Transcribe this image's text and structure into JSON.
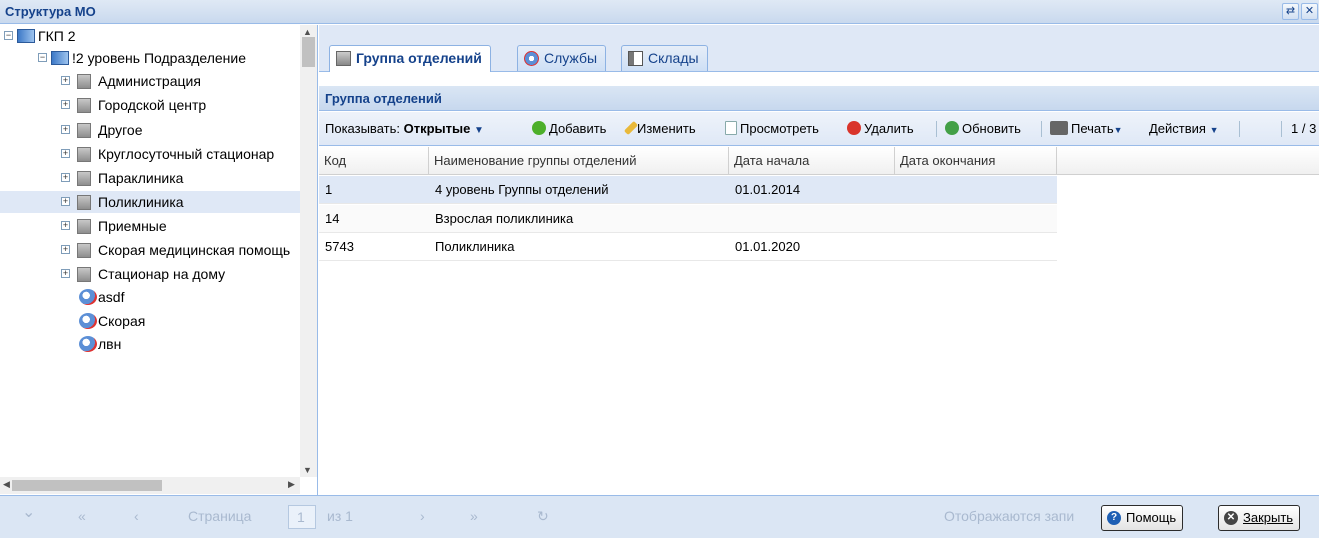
{
  "window": {
    "title": "Структура МО"
  },
  "tree": {
    "root": "ГКП 2",
    "level2": "!2 уровень Подразделение",
    "items": [
      {
        "label": "Администрация"
      },
      {
        "label": "Городской центр"
      },
      {
        "label": "Другое"
      },
      {
        "label": "Круглосуточный стационар"
      },
      {
        "label": "Параклиника"
      },
      {
        "label": "Поликлиника"
      },
      {
        "label": "Приемные"
      },
      {
        "label": "Скорая медицинская помощь"
      },
      {
        "label": "Стационар на дому"
      }
    ],
    "services": [
      {
        "label": "asdf"
      },
      {
        "label": "Скорая"
      },
      {
        "label": "лвн"
      }
    ],
    "selected": "Поликлиника"
  },
  "tabs": [
    {
      "label": "Группа отделений",
      "active": true
    },
    {
      "label": "Службы",
      "active": false
    },
    {
      "label": "Склады",
      "active": false
    }
  ],
  "panel": {
    "title": "Группа отделений"
  },
  "toolbar": {
    "show_label": "Показывать:",
    "show_value": "Открытые",
    "add": "Добавить",
    "edit": "Изменить",
    "view": "Просмотреть",
    "delete": "Удалить",
    "refresh": "Обновить",
    "print": "Печать",
    "actions": "Действия",
    "counter": "1 / 3"
  },
  "grid": {
    "columns": [
      "Код",
      "Наименование группы отделений",
      "Дата начала",
      "Дата окончания"
    ],
    "rows": [
      {
        "code": "1",
        "name": "4 уровень Группы отделений",
        "start": "01.01.2014",
        "end": ""
      },
      {
        "code": "14",
        "name": "Взрослая поликлиника",
        "start": "",
        "end": ""
      },
      {
        "code": "5743",
        "name": "Поликлиника",
        "start": "01.01.2020",
        "end": ""
      }
    ]
  },
  "pager": {
    "page_label": "Страница",
    "page_value": "1",
    "of_label": "из 1",
    "status": "Отображаются запи"
  },
  "buttons": {
    "help": "Помощь",
    "close": "Закрыть"
  },
  "colors": {
    "header": "#15428b",
    "selection": "#dfe8f6",
    "border": "#99bbe8"
  }
}
